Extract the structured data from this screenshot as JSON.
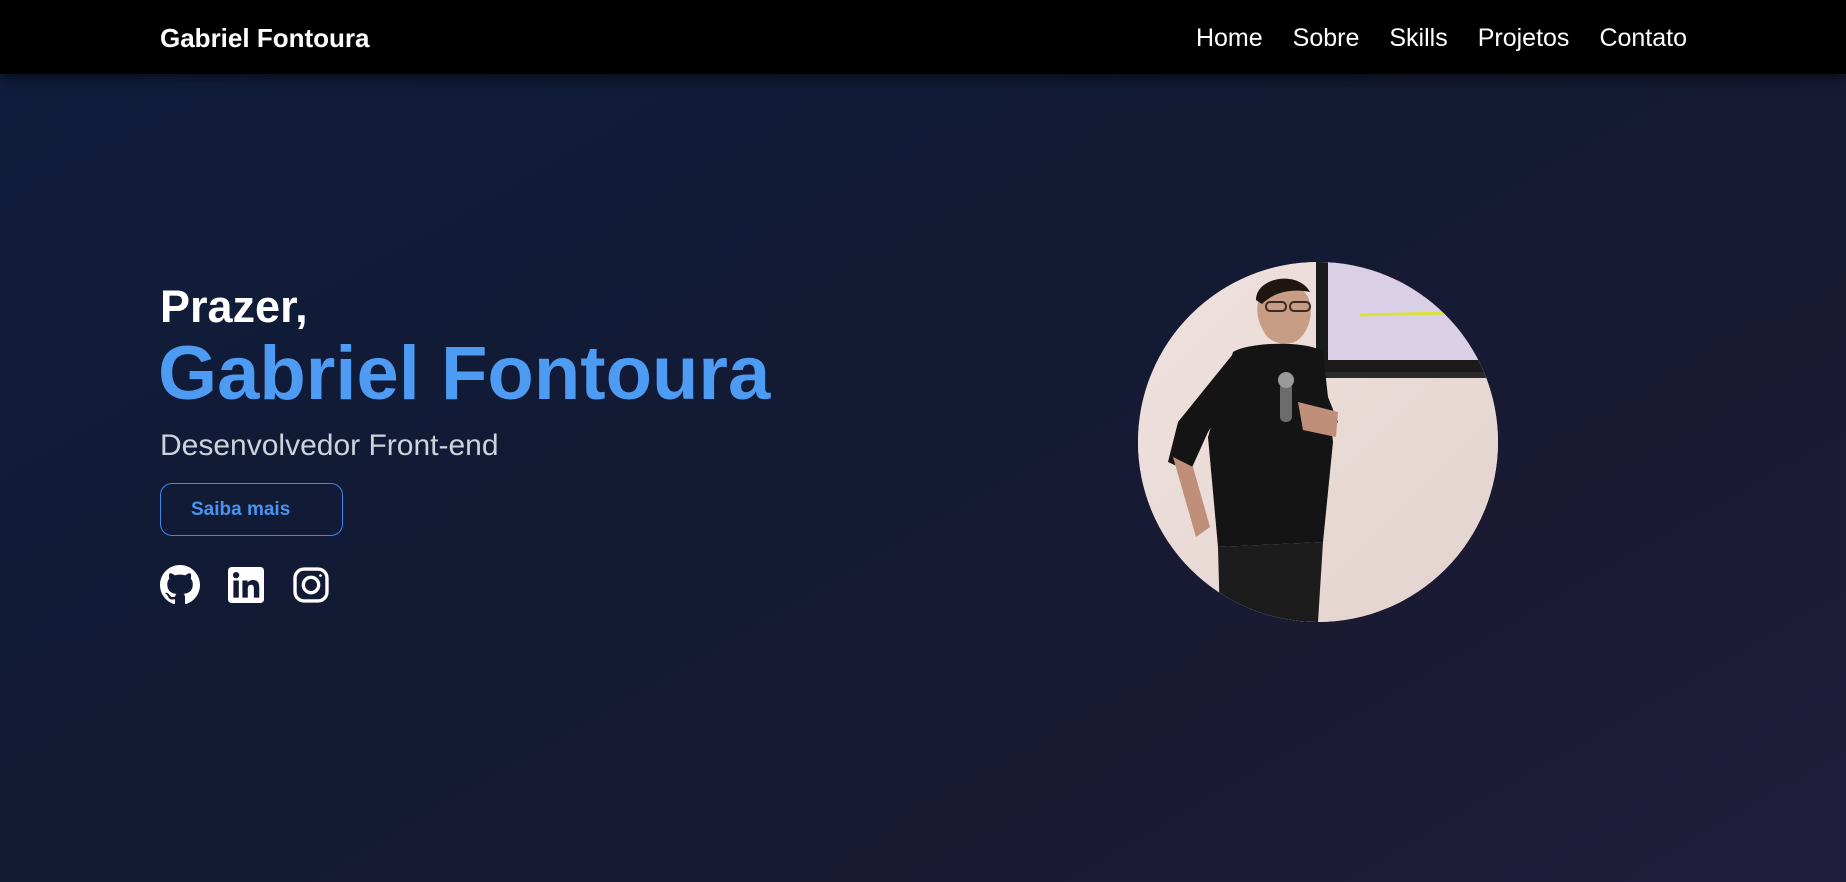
{
  "header": {
    "brand": "Gabriel Fontoura",
    "nav": [
      {
        "label": "Home"
      },
      {
        "label": "Sobre"
      },
      {
        "label": "Skills"
      },
      {
        "label": "Projetos"
      },
      {
        "label": "Contato"
      }
    ]
  },
  "hero": {
    "greeting": "Prazer,",
    "name": "Gabriel Fontoura",
    "role": "Desenvolvedor Front-end",
    "cta_label": "Saiba mais",
    "socials": [
      {
        "icon": "github-icon"
      },
      {
        "icon": "linkedin-icon"
      },
      {
        "icon": "instagram-icon"
      }
    ],
    "photo_alt": "Gabriel Fontoura"
  },
  "colors": {
    "accent": "#4d9bf2",
    "button_border": "#3f87e8",
    "nav_bg": "#000000",
    "hero_bg_start": "#0f1d3c",
    "hero_bg_end": "#211d3d"
  }
}
